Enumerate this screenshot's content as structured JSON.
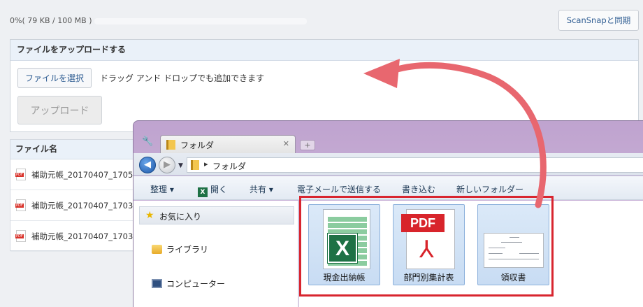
{
  "storage": {
    "text": "0%( 79 KB / 100 MB )",
    "percent": 0
  },
  "sync_button": "ScanSnapと同期",
  "upload": {
    "title": "ファイルをアップロードする",
    "choose_label": "ファイルを選択",
    "dnd_text": "ドラッグ アンド ドロップでも追加できます",
    "upload_label": "アップロード"
  },
  "file_list": {
    "header": "ファイル名",
    "rows": [
      "補助元帳_20170407_1705",
      "補助元帳_20170407_1703",
      "補助元帳_20170407_1703"
    ]
  },
  "explorer": {
    "tab_label": "フォルダ",
    "address": "フォルダ",
    "toolbar": {
      "organize": "整理 ▾",
      "open": "開く",
      "share": "共有 ▾",
      "email": "電子メールで送信する",
      "burn": "書き込む",
      "new_folder": "新しいフォルダー"
    },
    "nav": {
      "favorites": "お気に入り",
      "library": "ライブラリ",
      "computer": "コンピューター"
    },
    "files": [
      {
        "name": "現金出納帳",
        "icon": "excel-icon"
      },
      {
        "name": "部門別集計表",
        "icon": "pdf-icon"
      },
      {
        "name": "領収書",
        "icon": "receipt-icon"
      }
    ]
  },
  "colors": {
    "highlight_border": "#d8252f",
    "arrow": "#e8676f",
    "link": "#2e5c92"
  }
}
